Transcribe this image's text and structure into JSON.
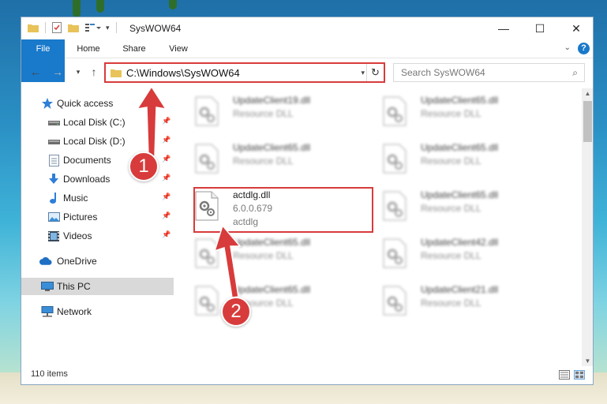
{
  "window": {
    "title": "SysWOW64",
    "controls": {
      "minimize": "—",
      "maximize": "☐",
      "close": "✕"
    }
  },
  "ribbon": {
    "tabs": [
      "File",
      "Home",
      "Share",
      "View"
    ],
    "help": "?"
  },
  "address": {
    "path": "C:\\Windows\\SysWOW64",
    "search_placeholder": "Search SysWOW64"
  },
  "sidebar": {
    "items": [
      {
        "label": "Quick access",
        "icon": "star-icon"
      },
      {
        "label": "Local Disk (C:)",
        "icon": "drive-icon",
        "pinned": true
      },
      {
        "label": "Local Disk (D:)",
        "icon": "drive-icon",
        "pinned": true
      },
      {
        "label": "Documents",
        "icon": "documents-icon",
        "pinned": true
      },
      {
        "label": "Downloads",
        "icon": "download-icon",
        "pinned": true
      },
      {
        "label": "Music",
        "icon": "music-icon",
        "pinned": true
      },
      {
        "label": "Pictures",
        "icon": "pictures-icon",
        "pinned": true
      },
      {
        "label": "Videos",
        "icon": "videos-icon",
        "pinned": true
      },
      {
        "label": "OneDrive",
        "icon": "cloud-icon"
      },
      {
        "label": "This PC",
        "icon": "pc-icon",
        "selected": true
      },
      {
        "label": "Network",
        "icon": "network-icon"
      }
    ]
  },
  "files": [
    {
      "name": "UpdateClient19.dll",
      "desc": "Resource DLL"
    },
    {
      "name": "UpdateClient65.dll",
      "desc": "Resource DLL"
    },
    {
      "name": "UpdateClient65.dll",
      "desc": "Resource DLL"
    },
    {
      "name": "UpdateClient65.dll",
      "desc": "Resource DLL"
    },
    {
      "name": "actdlg.dll",
      "desc": "6.0.0.679",
      "desc2": "actdlg",
      "highlighted": true
    },
    {
      "name": "UpdateClient65.dll",
      "desc": "Resource DLL"
    },
    {
      "name": "UpdateClient65.dll",
      "desc": "Resource DLL"
    },
    {
      "name": "UpdateClient42.dll",
      "desc": "Resource DLL"
    },
    {
      "name": "UpdateClient65.dll",
      "desc": "Resource DLL"
    },
    {
      "name": "UpdateClient21.dll",
      "desc": "Resource DLL"
    }
  ],
  "status": {
    "item_count": "110 items"
  },
  "annotations": {
    "step1": "1",
    "step2": "2"
  },
  "colors": {
    "accent": "#1979ca",
    "highlight": "#d83b3b"
  }
}
